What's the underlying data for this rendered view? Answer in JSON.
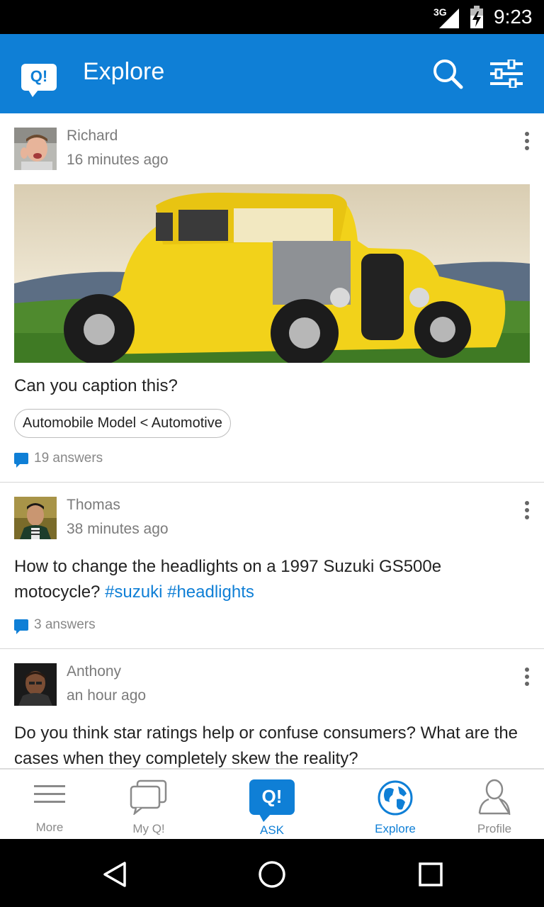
{
  "status_bar": {
    "network": "3G",
    "time": "9:23"
  },
  "app_bar": {
    "logo_text": "Q!",
    "title": "Explore"
  },
  "posts": [
    {
      "author": "Richard",
      "time": "16 minutes ago",
      "question": "Can you caption this?",
      "tag": "Automobile Model < Automotive",
      "answers": "19 answers"
    },
    {
      "author": "Thomas",
      "time": "38 minutes ago",
      "question_text": "How to change the headlights on a 1997 Suzuki GS500e motocycle?",
      "hashtags": [
        "#suzuki",
        "#headlights"
      ],
      "answers": "3 answers"
    },
    {
      "author": "Anthony",
      "time": "an hour ago",
      "question": "Do you think star ratings help or confuse consumers? What are the cases when they completely skew the reality?"
    }
  ],
  "bottom_nav": {
    "items": [
      {
        "label": "More",
        "icon": "menu-icon"
      },
      {
        "label": "My Q!",
        "icon": "chat-bubbles-icon"
      },
      {
        "label": "ASK",
        "icon": "ask-q-icon",
        "button_text": "Q!"
      },
      {
        "label": "Explore",
        "icon": "globe-icon",
        "active": true
      },
      {
        "label": "Profile",
        "icon": "person-icon"
      }
    ]
  },
  "colors": {
    "primary": "#0f7fd6",
    "muted_text": "#7b7b7b",
    "body_text": "#222222"
  }
}
